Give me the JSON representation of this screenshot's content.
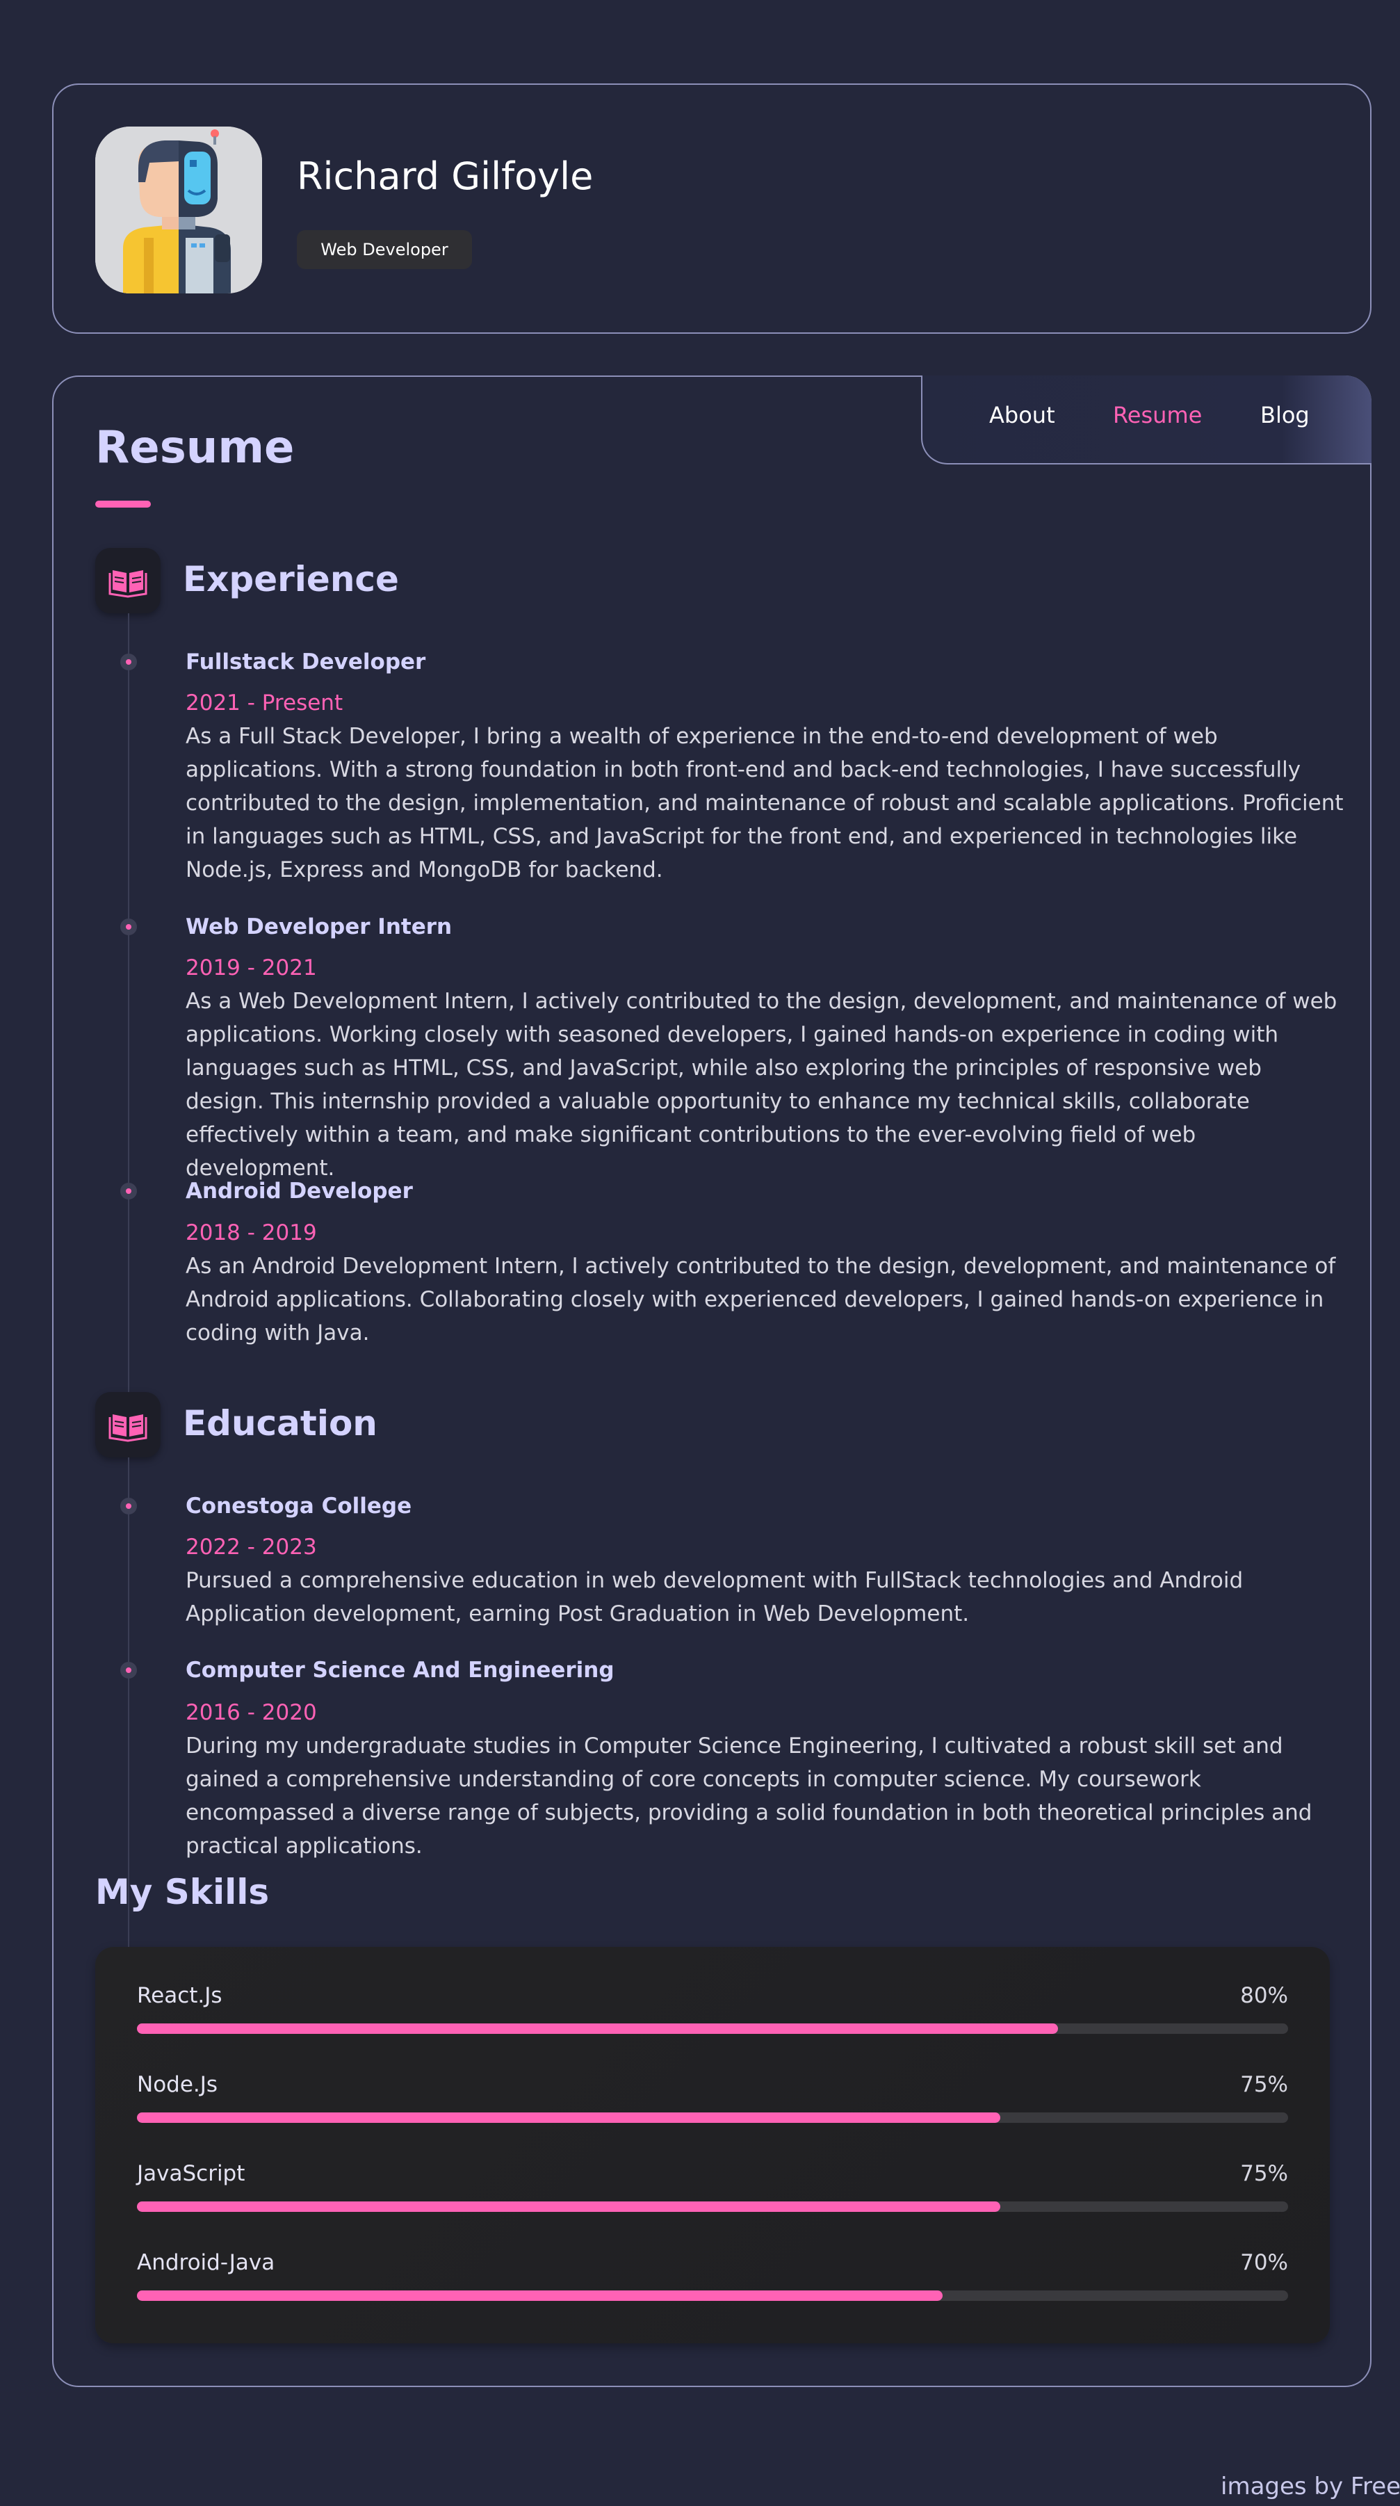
{
  "profile": {
    "name": "Richard Gilfoyle",
    "role": "Web Developer"
  },
  "nav": {
    "items": [
      {
        "label": "About",
        "active": false
      },
      {
        "label": "Resume",
        "active": true
      },
      {
        "label": "Blog",
        "active": false
      }
    ]
  },
  "resume": {
    "title": "Resume",
    "experience": {
      "title": "Experience",
      "icon": "book-open-icon",
      "items": [
        {
          "title": "Fullstack Developer",
          "date": "2021 - Present",
          "desc": "As a Full Stack Developer, I bring a wealth of experience in the end-to-end development of web applications. With a strong foundation in both front-end and back-end technologies, I have successfully contributed to the design, implementation, and maintenance of robust and scalable applications. Proficient in languages such as HTML, CSS, and JavaScript for the front end, and experienced in technologies like Node.js, Express and MongoDB for backend."
        },
        {
          "title": "Web Developer Intern",
          "date": "2019 - 2021",
          "desc": "As a Web Development Intern, I actively contributed to the design, development, and maintenance of web applications. Working closely with seasoned developers, I gained hands-on experience in coding with languages such as HTML, CSS, and JavaScript, while also exploring the principles of responsive web design. This internship provided a valuable opportunity to enhance my technical skills, collaborate effectively within a team, and make significant contributions to the ever-evolving field of web development."
        },
        {
          "title": "Android Developer",
          "date": "2018 - 2019",
          "desc": "As an Android Development Intern, I actively contributed to the design, development, and maintenance of Android applications. Collaborating closely with experienced developers, I gained hands-on experience in coding with Java."
        }
      ]
    },
    "education": {
      "title": "Education",
      "icon": "book-open-icon",
      "items": [
        {
          "title": "Conestoga College",
          "date": "2022 - 2023",
          "desc": "Pursued a comprehensive education in web development with FullStack technologies and Android Application development, earning Post Graduation in Web Development."
        },
        {
          "title": "Computer Science And Engineering",
          "date": "2016 - 2020",
          "desc": "During my undergraduate studies in Computer Science Engineering, I cultivated a robust skill set and gained a comprehensive understanding of core concepts in computer science. My coursework encompassed a diverse range of subjects, providing a solid foundation in both theoretical principles and practical applications."
        }
      ]
    },
    "skills": {
      "title": "My Skills",
      "items": [
        {
          "name": "React.Js",
          "percent_label": "80%",
          "level": 0.8
        },
        {
          "name": "Node.Js",
          "percent_label": "75%",
          "level": 0.75
        },
        {
          "name": "JavaScript",
          "percent_label": "75%",
          "level": 0.75
        },
        {
          "name": "Android-Java",
          "percent_label": "70%",
          "level": 0.7
        }
      ]
    }
  },
  "footer": {
    "credit": "images by Freep"
  },
  "colors": {
    "background": "#24273b",
    "accent": "#ff62b5",
    "heading": "#d4d3ff",
    "border": "#8c8fb8"
  }
}
